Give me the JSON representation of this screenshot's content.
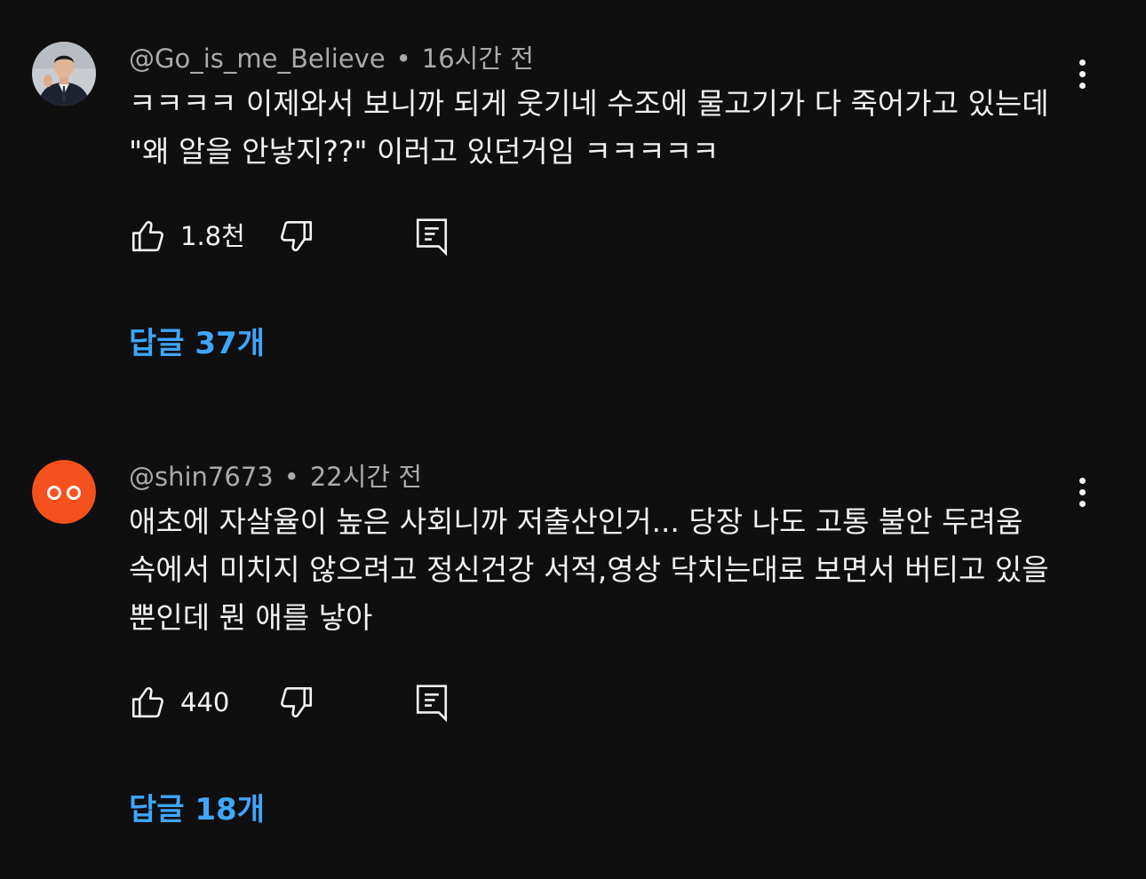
{
  "comments": [
    {
      "author": "@Go_is_me_Believe",
      "separator": "•",
      "time": "16시간 전",
      "lines": [
        "ㅋㅋㅋㅋ 이제와서 보니까 되게 웃기네 수조에 물고기가 다 죽어가고 있는데",
        "\"왜 알을 안낳지??\" 이러고 있던거임 ㅋㅋㅋㅋㅋ"
      ],
      "likes": "1.8천",
      "replies": "답글 37개",
      "avatar": "photo-avatar"
    },
    {
      "author": "@shin7673",
      "separator": "•",
      "time": "22시간 전",
      "lines": [
        "애초에 자살율이 높은 사회니까 저출산인거... 당장 나도 고통 불안 두려움",
        "속에서 미치지 않으려고 정신건강 서적,영상 닥치는대로 보면서 버티고 있을",
        "뿐인데 뭔 애를 낳아"
      ],
      "likes": "440",
      "replies": "답글 18개",
      "avatar": "orange-eyes-avatar",
      "avatar_color": "#f4511e"
    }
  ],
  "icons": {
    "like": "thumbs-up-icon",
    "dislike": "thumbs-down-icon",
    "reply": "reply-comment-icon",
    "more": "more-vert-icon"
  },
  "colors": {
    "background": "#0f0f0f",
    "link": "#3ea6ff",
    "muted": "#aaaaaa"
  }
}
